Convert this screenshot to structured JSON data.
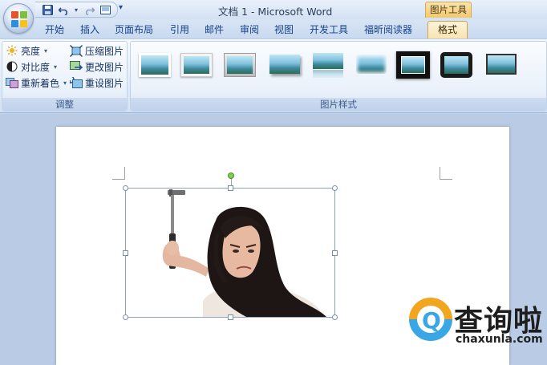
{
  "window": {
    "title": "文档 1 - Microsoft Word"
  },
  "context_tab": {
    "title": "图片工具"
  },
  "quick_access": {
    "icons": [
      "save-icon",
      "undo-icon",
      "redo-icon",
      "print-preview-icon",
      "customize-icon"
    ]
  },
  "tabs": [
    {
      "label": "开始",
      "active": false
    },
    {
      "label": "插入",
      "active": false
    },
    {
      "label": "页面布局",
      "active": false
    },
    {
      "label": "引用",
      "active": false
    },
    {
      "label": "邮件",
      "active": false
    },
    {
      "label": "审阅",
      "active": false
    },
    {
      "label": "视图",
      "active": false
    },
    {
      "label": "开发工具",
      "active": false
    },
    {
      "label": "福昕阅读器",
      "active": false
    },
    {
      "label": "格式",
      "active": true
    }
  ],
  "adjust_group": {
    "label": "调整",
    "brightness": "亮度",
    "contrast": "对比度",
    "recolor": "重新着色",
    "compress": "压缩图片",
    "change_picture": "更改图片",
    "reset_picture": "重设图片"
  },
  "picture_styles_group": {
    "label": "图片样式"
  },
  "watermark": {
    "text": "查询啦",
    "url": "chaxunla.com"
  },
  "colors": {
    "ribbon_text": "#15428b",
    "active_tab": "#f9e3b0",
    "context_tab": "#f3c86c"
  }
}
